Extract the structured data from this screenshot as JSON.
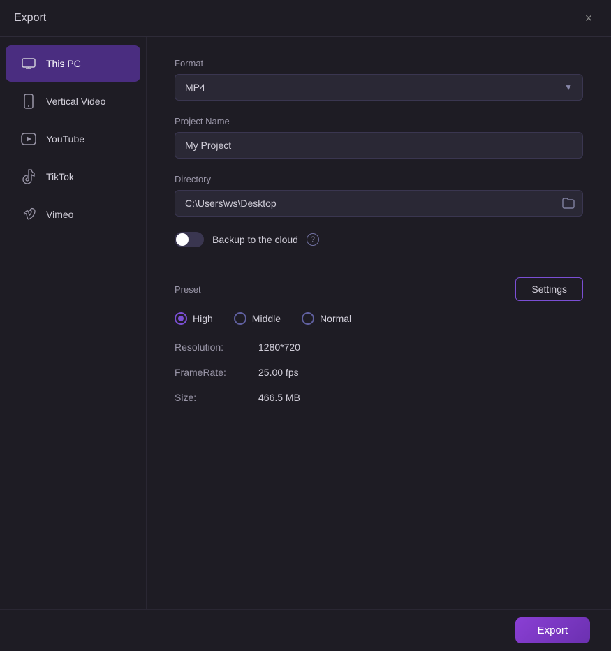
{
  "window": {
    "title": "Export",
    "close_label": "×"
  },
  "sidebar": {
    "items": [
      {
        "id": "this-pc",
        "label": "This PC",
        "active": true,
        "icon": "pc-icon"
      },
      {
        "id": "vertical-video",
        "label": "Vertical Video",
        "active": false,
        "icon": "phone-icon"
      },
      {
        "id": "youtube",
        "label": "YouTube",
        "active": false,
        "icon": "youtube-icon"
      },
      {
        "id": "tiktok",
        "label": "TikTok",
        "active": false,
        "icon": "tiktok-icon"
      },
      {
        "id": "vimeo",
        "label": "Vimeo",
        "active": false,
        "icon": "vimeo-icon"
      }
    ]
  },
  "content": {
    "format_label": "Format",
    "format_value": "MP4",
    "project_name_label": "Project Name",
    "project_name_value": "My Project",
    "directory_label": "Directory",
    "directory_value": "C:\\Users\\ws\\Desktop",
    "backup_label": "Backup to the cloud",
    "preset_label": "Preset",
    "settings_button_label": "Settings",
    "presets": [
      {
        "id": "high",
        "label": "High",
        "checked": true
      },
      {
        "id": "middle",
        "label": "Middle",
        "checked": false
      },
      {
        "id": "normal",
        "label": "Normal",
        "checked": false
      }
    ],
    "resolution_key": "Resolution:",
    "resolution_value": "1280*720",
    "framerate_key": "FrameRate:",
    "framerate_value": "25.00 fps",
    "size_key": "Size:",
    "size_value": "466.5 MB"
  },
  "footer": {
    "export_label": "Export"
  }
}
